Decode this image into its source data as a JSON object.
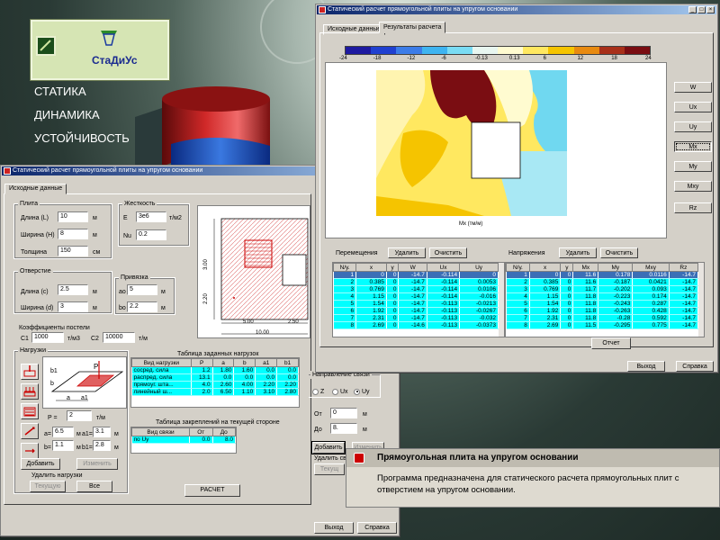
{
  "brand": {
    "name": "СтаДиУс",
    "menu": [
      "СТАТИКА",
      "ДИНАМИКА",
      "УСТОЙЧИВОСТЬ"
    ]
  },
  "colors": {
    "title_bar": "#0a246a",
    "grid_cell": "#00ffff",
    "selected_row": "#3b6fb6",
    "contour_hot": "#7a0d12",
    "contour_warm": "#f5c400",
    "contour_cool": "#70d8f0"
  },
  "front_window": {
    "title": "Статический расчет прямоугольной плиты на упругом основании",
    "tab": "Исходные данные",
    "plate": {
      "title": "Плита",
      "length_label": "Длина (L)",
      "length": "10",
      "width_label": "Ширина (H)",
      "width": "8",
      "thickness_label": "Толщина",
      "thickness": "150",
      "unit_m": "м",
      "unit_cm": "см"
    },
    "stiffness": {
      "title": "Жесткость",
      "e_label": "E",
      "e": "3e6",
      "e_unit": "т/м2",
      "nu_label": "Nu",
      "nu": "0.2"
    },
    "hole": {
      "title": "Отверстие",
      "length_label": "Длина (c)",
      "length": "2.5",
      "width_label": "Ширина (d)",
      "width": "3",
      "unit": "м"
    },
    "anchor": {
      "title": "Привязка",
      "ao_label": "ao",
      "ao": "5",
      "bo_label": "bo",
      "bo": "2.2",
      "unit": "м"
    },
    "bed": {
      "title": "Коэффициенты постели",
      "c1_label": "C1",
      "c1": "1000",
      "c1_unit": "т/м3",
      "c2_label": "C2",
      "c2": "10000",
      "c2_unit": "т/м"
    },
    "loads": {
      "title": "Нагрузки",
      "p_label": "P =",
      "p": "2",
      "p_unit": "т/м",
      "a_label": "a=",
      "a": "6.5",
      "a1_label": "a1=",
      "a1": "3.1",
      "b_label": "b=",
      "b": "1.1",
      "b1_label": "b1=",
      "b1": "2.8",
      "unit": "м",
      "add": "Добавить",
      "edit": "Изменить",
      "del_title": "Удалить нагрузки",
      "del_cur": "Текущую",
      "del_all": "Все"
    },
    "diagram_labels": {
      "p": "P",
      "b1": "b1",
      "b": "b",
      "a": "a",
      "a1": "a1"
    },
    "drawing": {
      "dim_5": "5.00",
      "dim_250": "2.50",
      "dim_10": "10.00",
      "dim_3": "3.00",
      "dim_22": "2.20"
    },
    "load_table": {
      "title": "Таблица заданных нагрузок",
      "headers": [
        "Вид нагрузки",
        "P",
        "a",
        "b",
        "a1",
        "b1"
      ],
      "rows": [
        [
          "сосред. сила",
          "1.2",
          "1.80",
          "1.60",
          "0.0",
          "0.0"
        ],
        [
          "распред. сила",
          "13.1",
          "0.0",
          "0.0",
          "0.0",
          "0.0"
        ],
        [
          "прямоуг. шта...",
          "4.0",
          "2.60",
          "4.00",
          "2.20",
          "2.20"
        ],
        [
          "линейный ш...",
          "2.0",
          "6.50",
          "1.10",
          "3.10",
          "2.80"
        ]
      ]
    },
    "fix_table": {
      "title": "Таблица закреплений на текущей стороне",
      "headers": [
        "Вид связи",
        "От",
        "До"
      ],
      "rows": [
        [
          "по Uy",
          "0.0",
          "8.0"
        ]
      ]
    },
    "links": {
      "direction_title": "Направление связи",
      "opts": [
        "Z",
        "Ux",
        "Uy"
      ],
      "selected": "Uy",
      "from_label": "От",
      "from": "0",
      "to_label": "До",
      "to": "8.",
      "unit": "м",
      "add": "Добавить",
      "edit": "Изменить",
      "del_title": "Удалить свя",
      "del_cur": "Текущ"
    },
    "calc_button": "РАСЧЕТ",
    "exit_button": "Выход",
    "help_button": "Справка"
  },
  "results_window": {
    "title": "Статический расчет прямоугольной плиты на упругом основании",
    "tabs": [
      "Исходные данные",
      "Результаты расчета"
    ],
    "scale_labels": [
      "-24",
      "-18",
      "-12",
      "-6",
      "-0.13",
      "0.13",
      "6",
      "12",
      "18",
      "24"
    ],
    "scale_colors": [
      "#1e1aa0",
      "#2040d0",
      "#3c7ce8",
      "#3fb4f0",
      "#7adcf4",
      "#e8f6f0",
      "#fffbd0",
      "#ffe860",
      "#f5c400",
      "#e88a10",
      "#a8301a",
      "#7a0d12"
    ],
    "plot_caption": "Mx (тм/м)",
    "side_buttons": [
      "W",
      "Ux",
      "Uy",
      "Mx",
      "My",
      "Mxy",
      "Rz"
    ],
    "active_side": "Mx",
    "disp": {
      "title": "Перемещения",
      "delete": "Удалить",
      "clear": "Очистить",
      "headers": [
        "N/у.",
        "x",
        "y",
        "W",
        "Ux",
        "Uy"
      ],
      "rows": [
        [
          "1",
          "0",
          "0",
          "-14.7",
          "-0.114",
          "0"
        ],
        [
          "2",
          "0.385",
          "0",
          "-14.7",
          "-0.114",
          "0.0053"
        ],
        [
          "3",
          "0.769",
          "0",
          "-14.7",
          "-0.114",
          "0.0106"
        ],
        [
          "4",
          "1.15",
          "0",
          "-14.7",
          "-0.114",
          "-0.016"
        ],
        [
          "5",
          "1.54",
          "0",
          "-14.7",
          "-0.113",
          "-0.0213"
        ],
        [
          "6",
          "1.92",
          "0",
          "-14.7",
          "-0.113",
          "-0.0267"
        ],
        [
          "7",
          "2.31",
          "0",
          "-14.7",
          "-0.113",
          "-0.032"
        ],
        [
          "8",
          "2.69",
          "0",
          "-14.6",
          "-0.113",
          "-0.0373"
        ]
      ]
    },
    "stress": {
      "title": "Напряжения",
      "delete": "Удалить",
      "clear": "Очистить",
      "headers": [
        "N/у.",
        "x",
        "y",
        "Mx",
        "My",
        "Mxy",
        "Rz"
      ],
      "rows": [
        [
          "1",
          "0",
          "0",
          "11.6",
          "0.178",
          "0.0116",
          "-14.7"
        ],
        [
          "2",
          "0.385",
          "0",
          "11.6",
          "-0.187",
          "0.0421",
          "-14.7"
        ],
        [
          "3",
          "0.769",
          "0",
          "11.7",
          "-0.202",
          "0.093",
          "-14.7"
        ],
        [
          "4",
          "1.15",
          "0",
          "11.8",
          "-0.223",
          "0.174",
          "-14.7"
        ],
        [
          "5",
          "1.54",
          "0",
          "11.8",
          "-0.243",
          "0.287",
          "-14.7"
        ],
        [
          "6",
          "1.92",
          "0",
          "11.8",
          "-0.263",
          "0.428",
          "-14.7"
        ],
        [
          "7",
          "2.31",
          "0",
          "11.8",
          "-0.28",
          "0.592",
          "-14.7"
        ],
        [
          "8",
          "2.69",
          "0",
          "11.5",
          "-0.295",
          "0.775",
          "-14.7"
        ]
      ],
      "report": "Отчет"
    },
    "exit_button": "Выход",
    "help_button": "Справка"
  },
  "tooltip": {
    "title": "Прямоугольная плита на упругом основании",
    "body": "Программа предназначена для статического расчета прямоугольных плит с отверстием на упругом основании."
  }
}
